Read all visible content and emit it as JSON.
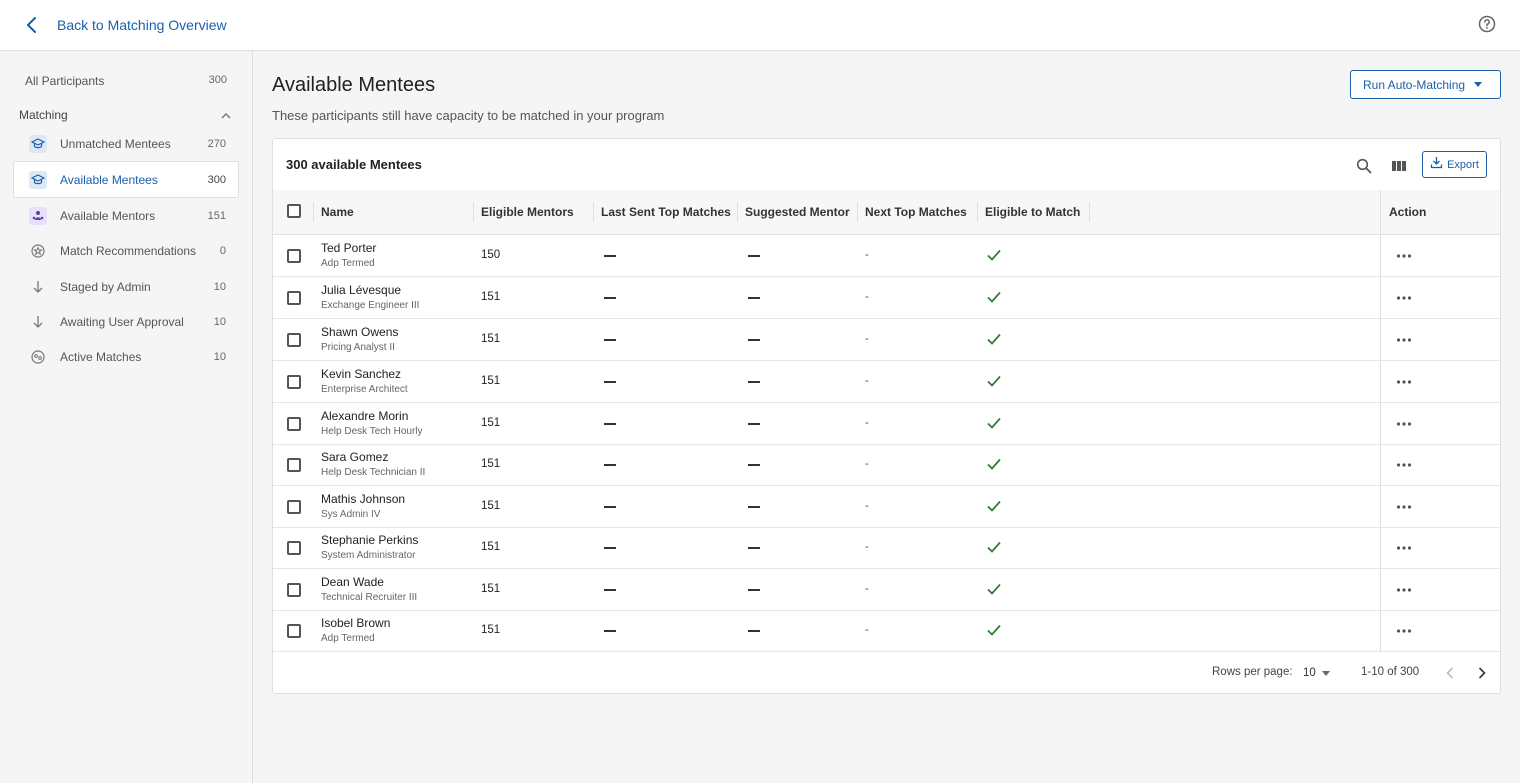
{
  "header": {
    "back_label": "Back to Matching Overview",
    "help_icon": "help-circle-icon"
  },
  "sidebar": {
    "all": {
      "label": "All Participants",
      "count": "300"
    },
    "section_label": "Matching",
    "items": [
      {
        "label": "Unmatched Mentees",
        "count": "270",
        "icon": "mortarboard-icon"
      },
      {
        "label": "Available Mentees",
        "count": "300",
        "icon": "mortarboard-icon",
        "active": true
      },
      {
        "label": "Available Mentors",
        "count": "151",
        "icon": "people-icon"
      },
      {
        "label": "Match Recommendations",
        "count": "0",
        "icon": "star-badge-icon"
      },
      {
        "label": "Staged by Admin",
        "count": "10",
        "icon": "arrow-down-icon"
      },
      {
        "label": "Awaiting User Approval",
        "count": "10",
        "icon": "arrow-down-icon"
      },
      {
        "label": "Active Matches",
        "count": "10",
        "icon": "match-faces-icon"
      }
    ]
  },
  "main": {
    "title": "Available Mentees",
    "subtitle": "These participants still have capacity to be matched in your program",
    "run_button": "Run Auto-Matching"
  },
  "table": {
    "title": "300 available Mentees",
    "export_label": "Export",
    "columns": {
      "name": "Name",
      "eligible_mentors": "Eligible Mentors",
      "last_sent": "Last Sent Top Matches",
      "suggested": "Suggested Mentor",
      "next_top": "Next Top Matches",
      "eligible_to_match": "Eligible to Match",
      "action": "Action"
    },
    "rows": [
      {
        "name": "Ted Porter",
        "title": "Adp Termed",
        "eligible": "150",
        "next": "-"
      },
      {
        "name": "Julia Lévesque",
        "title": "Exchange Engineer III",
        "eligible": "151",
        "next": "-"
      },
      {
        "name": "Shawn Owens",
        "title": "Pricing Analyst II",
        "eligible": "151",
        "next": "-"
      },
      {
        "name": "Kevin Sanchez",
        "title": "Enterprise Architect",
        "eligible": "151",
        "next": "-"
      },
      {
        "name": "Alexandre Morin",
        "title": "Help Desk Tech Hourly",
        "eligible": "151",
        "next": "-"
      },
      {
        "name": "Sara Gomez",
        "title": "Help Desk Technician II",
        "eligible": "151",
        "next": "-"
      },
      {
        "name": "Mathis Johnson",
        "title": "Sys Admin IV",
        "eligible": "151",
        "next": "-"
      },
      {
        "name": "Stephanie Perkins",
        "title": "System Administrator",
        "eligible": "151",
        "next": "-"
      },
      {
        "name": "Dean Wade",
        "title": "Technical Recruiter III",
        "eligible": "151",
        "next": "-"
      },
      {
        "name": "Isobel Brown",
        "title": "Adp Termed",
        "eligible": "151",
        "next": "-"
      }
    ],
    "footer": {
      "rows_per_page_label": "Rows per page:",
      "rows_per_page": "10",
      "range": "1-10 of 300"
    }
  },
  "colors": {
    "accent": "#1b5fab",
    "check": "#2e7d32"
  }
}
